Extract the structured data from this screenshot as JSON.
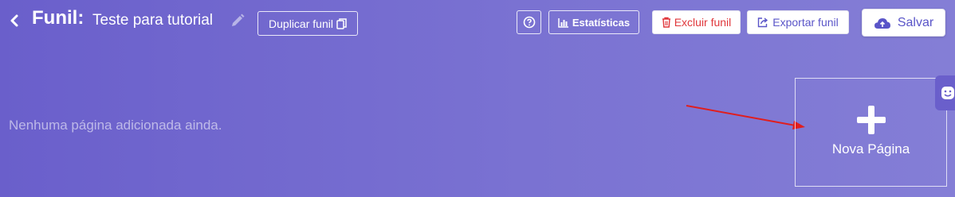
{
  "header": {
    "back_icon": "chevron-left-icon",
    "title_prefix": "Funil:",
    "funnel_name": "Teste para tutorial",
    "duplicate_label": "Duplicar funil",
    "stats_label": "Estatísticas",
    "delete_label": "Excluir funil",
    "export_label": "Exportar funil",
    "save_label": "Salvar"
  },
  "main": {
    "empty_message": "Nenhuma página adicionada ainda.",
    "new_page_label": "Nova Página"
  },
  "colors": {
    "background_start": "#6a5fcb",
    "background_end": "#847ed6",
    "accent": "#5a55c8",
    "danger": "#e0373b",
    "annotation_arrow": "#e01e1e"
  }
}
